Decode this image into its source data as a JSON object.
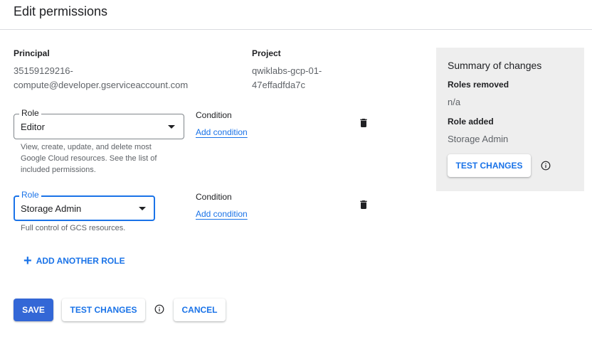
{
  "header": {
    "title": "Edit permissions"
  },
  "principal": {
    "label": "Principal",
    "value_line1": "35159129216-",
    "value_line2": "compute@developer.gserviceaccount.com"
  },
  "project": {
    "label": "Project",
    "value_line1": "qwiklabs-gcp-01-",
    "value_line2": "47effadfda7c"
  },
  "roles": [
    {
      "legend": "Role",
      "selected": "Editor",
      "helper_line1": "View, create, update, and delete most",
      "helper_line2": "Google Cloud resources. See the list of",
      "helper_line3": "included permissions.",
      "condition_label": "Condition",
      "condition_link": "Add condition"
    },
    {
      "legend": "Role",
      "selected": "Storage Admin",
      "helper_line1": "Full control of GCS resources.",
      "condition_label": "Condition",
      "condition_link": "Add condition"
    }
  ],
  "add_role": {
    "label": "ADD ANOTHER ROLE"
  },
  "actions": {
    "save": "SAVE",
    "test": "TEST CHANGES",
    "cancel": "CANCEL"
  },
  "summary": {
    "title": "Summary of changes",
    "removed_label": "Roles removed",
    "removed_value": "n/a",
    "added_label": "Role added",
    "added_value": "Storage Admin",
    "test_button": "TEST CHANGES"
  },
  "colors": {
    "accent": "#1a73e8",
    "primary_button": "#3367d6",
    "summary_bg": "#eeeeee"
  },
  "icons": {
    "delete": "trash-icon",
    "info": "info-icon",
    "add": "plus-icon",
    "dropdown": "caret-down-icon"
  }
}
